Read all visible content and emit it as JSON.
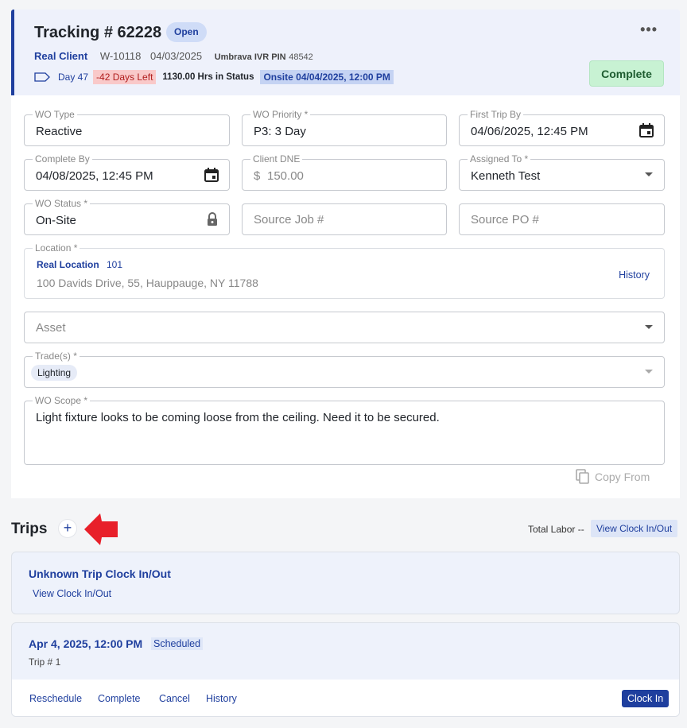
{
  "header": {
    "title": "Tracking # 62228",
    "status_badge": "Open",
    "menu_label": "•••",
    "client": "Real Client",
    "wo_number": "W-10118",
    "date": "04/03/2025",
    "ivr_pin_label": "Umbrava IVR PIN",
    "ivr_pin": "48542",
    "day": "Day 47",
    "days_left": "-42 Days Left",
    "hrs_in_status": "1130.00 Hrs in Status",
    "onsite": "Onsite 04/04/2025, 12:00 PM",
    "complete_label": "Complete"
  },
  "form": {
    "wo_type": {
      "label": "WO Type",
      "value": "Reactive"
    },
    "wo_priority": {
      "label": "WO Priority *",
      "value": "P3: 3 Day"
    },
    "first_trip_by": {
      "label": "First Trip By",
      "value": "04/06/2025, 12:45 PM"
    },
    "complete_by": {
      "label": "Complete By",
      "value": "04/08/2025, 12:45 PM"
    },
    "client_dne": {
      "label": "Client DNE",
      "currency": "$",
      "placeholder": "150.00"
    },
    "assigned_to": {
      "label": "Assigned To *",
      "value": "Kenneth Test"
    },
    "wo_status": {
      "label": "WO Status *",
      "value": "On-Site"
    },
    "source_job": {
      "placeholder": "Source Job #"
    },
    "source_po": {
      "placeholder": "Source PO #"
    },
    "location": {
      "label": "Location *",
      "name": "Real Location",
      "number": "101",
      "address": "100 Davids Drive, 55, Hauppauge, NY 11788",
      "history_label": "History"
    },
    "asset": {
      "placeholder": "Asset"
    },
    "trades": {
      "label": "Trade(s) *",
      "chips": [
        "Lighting"
      ]
    },
    "wo_scope": {
      "label": "WO Scope *",
      "value": "Light fixture looks to be coming loose from the ceiling. Need it to be  secured."
    },
    "copy_from_label": "Copy From"
  },
  "trips": {
    "title": "Trips",
    "add_label": "+",
    "total_labor": "Total Labor --",
    "view_clock_label": "View Clock In/Out",
    "unknown_trip": {
      "title": "Unknown Trip Clock In/Out",
      "link": "View Clock In/Out"
    },
    "trip1": {
      "date": "Apr 4, 2025, 12:00 PM",
      "status": "Scheduled",
      "trip_number": "Trip # 1",
      "actions": {
        "reschedule": "Reschedule",
        "complete": "Complete",
        "cancel": "Cancel",
        "history": "History",
        "clock_in": "Clock In"
      }
    }
  },
  "colors": {
    "accent": "#1f3f9e",
    "header_bg": "#eef1fb",
    "complete_bg": "#c8f2d3",
    "days_left_bg": "#f9c9c9",
    "arrow": "#e8202a"
  },
  "icons": [
    "tag-icon",
    "calendar-icon",
    "lock-icon",
    "copy-icon",
    "chevron-down-icon",
    "more-icon",
    "red-arrow-icon"
  ]
}
